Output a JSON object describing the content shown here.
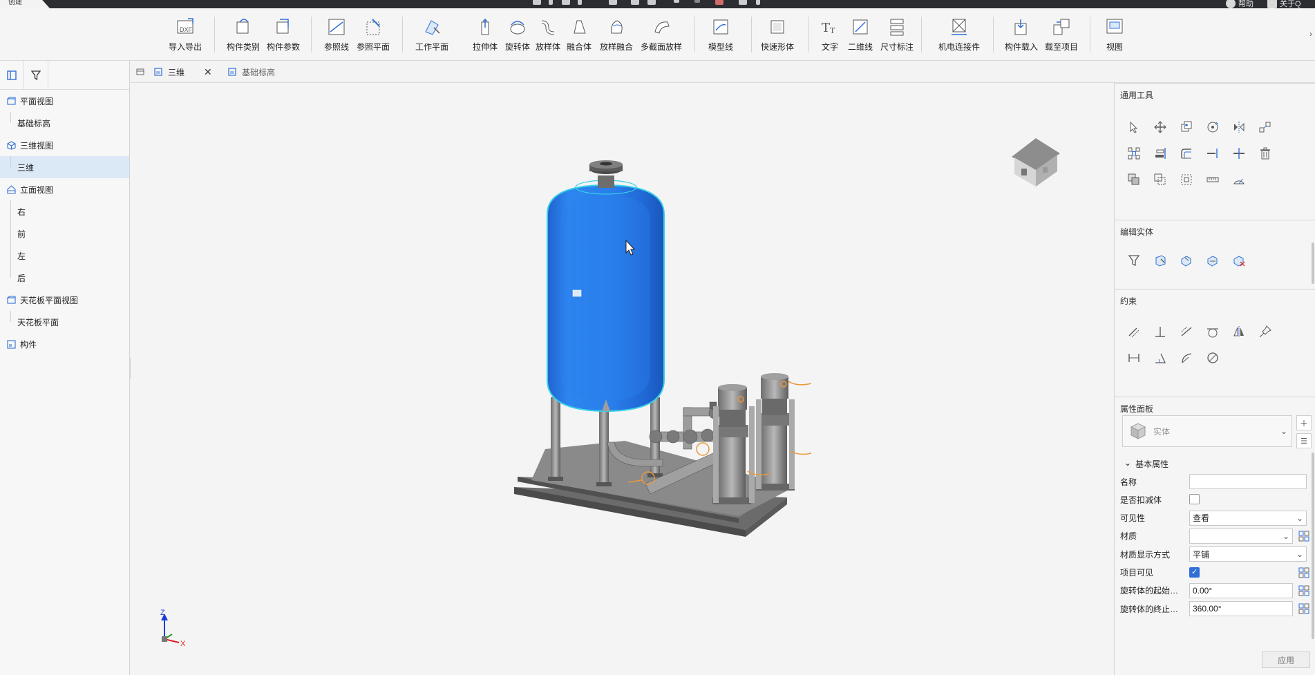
{
  "topbar": {
    "create_tab": "创建",
    "help": "帮助",
    "about": "关于Q"
  },
  "ribbon": {
    "buttons": [
      {
        "id": "import-export",
        "label": "导入导出",
        "icon": "dxf-icon"
      },
      {
        "id": "component-category",
        "label": "构件类别",
        "icon": "component-category-icon"
      },
      {
        "id": "component-params",
        "label": "构件参数",
        "icon": "component-params-icon"
      },
      {
        "id": "reference-line",
        "label": "参照线",
        "icon": "reference-line-icon"
      },
      {
        "id": "reference-plane",
        "label": "参照平面",
        "icon": "reference-plane-icon"
      },
      {
        "id": "work-plane",
        "label": "工作平面",
        "icon": "work-plane-icon"
      },
      {
        "id": "extrude",
        "label": "拉伸体",
        "icon": "extrude-icon"
      },
      {
        "id": "revolve",
        "label": "旋转体",
        "icon": "revolve-icon"
      },
      {
        "id": "sweep",
        "label": "放样体",
        "icon": "sweep-icon"
      },
      {
        "id": "blend",
        "label": "融合体",
        "icon": "blend-icon"
      },
      {
        "id": "swept-blend",
        "label": "放样融合",
        "icon": "swept-blend-icon"
      },
      {
        "id": "multi-section-sweep",
        "label": "多截面放样",
        "icon": "multi-section-sweep-icon"
      },
      {
        "id": "model-line",
        "label": "模型线",
        "icon": "model-line-icon"
      },
      {
        "id": "quick-shape",
        "label": "快速形体",
        "icon": "quick-shape-icon"
      },
      {
        "id": "text",
        "label": "文字",
        "icon": "text-icon"
      },
      {
        "id": "2d-line",
        "label": "二维线",
        "icon": "2d-line-icon"
      },
      {
        "id": "dimension",
        "label": "尺寸标注",
        "icon": "dimension-icon"
      },
      {
        "id": "mep-connector",
        "label": "机电连接件",
        "icon": "mep-connector-icon"
      },
      {
        "id": "load-component",
        "label": "构件载入",
        "icon": "load-component-icon"
      },
      {
        "id": "load-to-project",
        "label": "载至项目",
        "icon": "load-to-project-icon"
      },
      {
        "id": "view",
        "label": "视图",
        "icon": "view-icon"
      }
    ]
  },
  "tree": {
    "items": [
      {
        "type": "parent",
        "label": "平面视图",
        "icon": "plan-view-icon"
      },
      {
        "type": "child",
        "label": "基础标高"
      },
      {
        "type": "parent",
        "label": "三维视图",
        "icon": "cube-icon"
      },
      {
        "type": "child",
        "label": "三维",
        "selected": true
      },
      {
        "type": "parent",
        "label": "立面视图",
        "icon": "elevation-icon"
      },
      {
        "type": "child",
        "label": "右"
      },
      {
        "type": "child",
        "label": "前"
      },
      {
        "type": "child",
        "label": "左"
      },
      {
        "type": "child",
        "label": "后"
      },
      {
        "type": "parent",
        "label": "天花板平面视图",
        "icon": "plan-view-icon"
      },
      {
        "type": "child",
        "label": "天花板平面"
      },
      {
        "type": "parent",
        "label": "构件",
        "icon": "component-icon"
      }
    ]
  },
  "doc_tabs": [
    {
      "label": "三维",
      "active": true
    },
    {
      "label": "基础标高",
      "active": false
    }
  ],
  "viewport": {
    "axis_labels": {
      "z": "Z",
      "x": "X"
    }
  },
  "panels": {
    "general_tools": {
      "title": "通用工具"
    },
    "edit_solid": {
      "title": "编辑实体"
    },
    "constraints": {
      "title": "约束"
    },
    "properties": {
      "title": "属性面板",
      "type_selector": "实体",
      "section": "基本属性",
      "rows": [
        {
          "key": "name",
          "label": "名称",
          "kind": "input",
          "value": ""
        },
        {
          "key": "void",
          "label": "是否扣减体",
          "kind": "checkbox",
          "checked": false
        },
        {
          "key": "visibility",
          "label": "可见性",
          "kind": "select",
          "value": "查看"
        },
        {
          "key": "material",
          "label": "材质",
          "kind": "select",
          "value": ""
        },
        {
          "key": "material_display",
          "label": "材质显示方式",
          "kind": "select",
          "value": "平铺"
        },
        {
          "key": "project_visible",
          "label": "项目可见",
          "kind": "checkbox",
          "checked": true
        },
        {
          "key": "rev_start",
          "label": "旋转体的起始…",
          "kind": "input",
          "value": "0.00°"
        },
        {
          "key": "rev_end",
          "label": "旋转体的终止…",
          "kind": "input",
          "value": "360.00°"
        }
      ],
      "apply": "应用"
    }
  },
  "colors": {
    "tank": "#2878e6",
    "tank_dark": "#1c5fc4",
    "selection": "#39d0e8",
    "steel": "#8c8c8c",
    "accent": "#2f6fd6"
  }
}
